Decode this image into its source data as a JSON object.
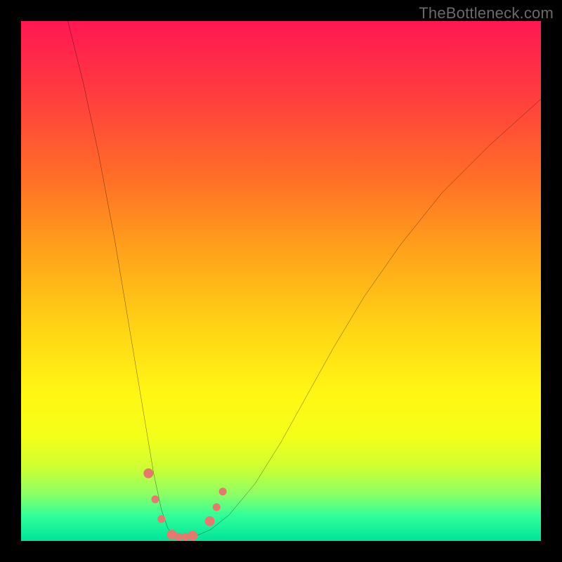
{
  "watermark": "TheBottleneck.com",
  "chart_data": {
    "type": "line",
    "title": "",
    "xlabel": "",
    "ylabel": "",
    "xlim": [
      0,
      100
    ],
    "ylim": [
      0,
      100
    ],
    "background_gradient": {
      "stops": [
        {
          "offset": 0.0,
          "color": "#ff1753"
        },
        {
          "offset": 0.14,
          "color": "#ff3c3f"
        },
        {
          "offset": 0.3,
          "color": "#ff6e27"
        },
        {
          "offset": 0.45,
          "color": "#ffa51a"
        },
        {
          "offset": 0.6,
          "color": "#ffd714"
        },
        {
          "offset": 0.72,
          "color": "#fff714"
        },
        {
          "offset": 0.8,
          "color": "#f4ff19"
        },
        {
          "offset": 0.86,
          "color": "#ccff33"
        },
        {
          "offset": 0.91,
          "color": "#8cff66"
        },
        {
          "offset": 0.95,
          "color": "#33ff99"
        },
        {
          "offset": 1.0,
          "color": "#00e49b"
        }
      ]
    },
    "series": [
      {
        "name": "bottleneck-curve",
        "color": "#000000",
        "width": 2,
        "x": [
          9,
          12,
          15,
          18,
          20,
          22,
          24,
          25.5,
          27,
          28.2,
          29.3,
          30.5,
          32,
          34,
          36.5,
          40,
          45,
          50,
          55,
          60,
          66,
          73,
          81,
          90,
          100
        ],
        "y": [
          100,
          88,
          74,
          58,
          46,
          34,
          22,
          13,
          6,
          2.5,
          1.0,
          0.8,
          0.8,
          1.1,
          2.2,
          5,
          11,
          19,
          28,
          37,
          47,
          57,
          67,
          76,
          85
        ]
      }
    ],
    "markers": {
      "name": "highlight-dots",
      "color": "#e8776e",
      "radius_primary": 7,
      "radius_secondary": 5.5,
      "points": [
        {
          "x": 24.5,
          "y": 13.0,
          "r": "primary"
        },
        {
          "x": 25.8,
          "y": 8.0,
          "r": "secondary"
        },
        {
          "x": 27.0,
          "y": 4.2,
          "r": "secondary"
        },
        {
          "x": 29.0,
          "y": 1.2,
          "r": "primary"
        },
        {
          "x": 30.3,
          "y": 0.8,
          "r": "secondary"
        },
        {
          "x": 31.6,
          "y": 0.8,
          "r": "secondary"
        },
        {
          "x": 33.0,
          "y": 1.0,
          "r": "primary"
        },
        {
          "x": 36.3,
          "y": 3.8,
          "r": "primary"
        },
        {
          "x": 37.6,
          "y": 6.5,
          "r": "secondary"
        },
        {
          "x": 38.8,
          "y": 9.5,
          "r": "secondary"
        }
      ]
    }
  }
}
